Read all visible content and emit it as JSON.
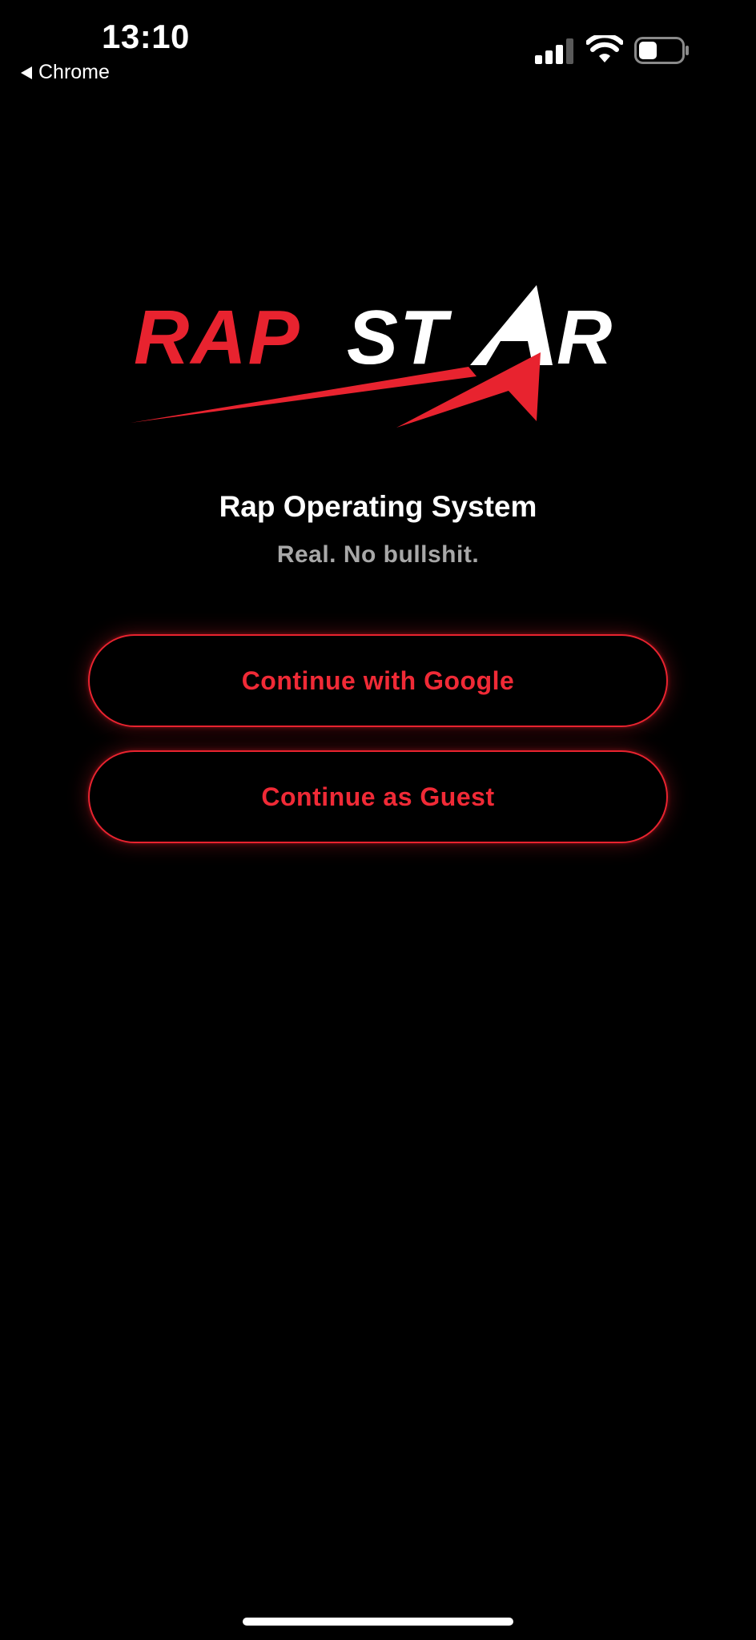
{
  "status_bar": {
    "time": "13:10",
    "back_app": "Chrome",
    "icons": [
      "back-arrow-icon",
      "cellular-signal-icon",
      "wifi-icon",
      "battery-icon"
    ]
  },
  "logo": {
    "brand_text": "RAPSTAR",
    "colors": {
      "red": "#e8232f",
      "white": "#ffffff"
    }
  },
  "headline": "Rap Operating System",
  "tagline": "Real. No bullshit.",
  "buttons": {
    "google_label": "Continue with Google",
    "guest_label": "Continue as Guest"
  },
  "theme": {
    "background": "#000000",
    "accent": "#e8232f",
    "tagline_color": "#a8a8a8"
  }
}
